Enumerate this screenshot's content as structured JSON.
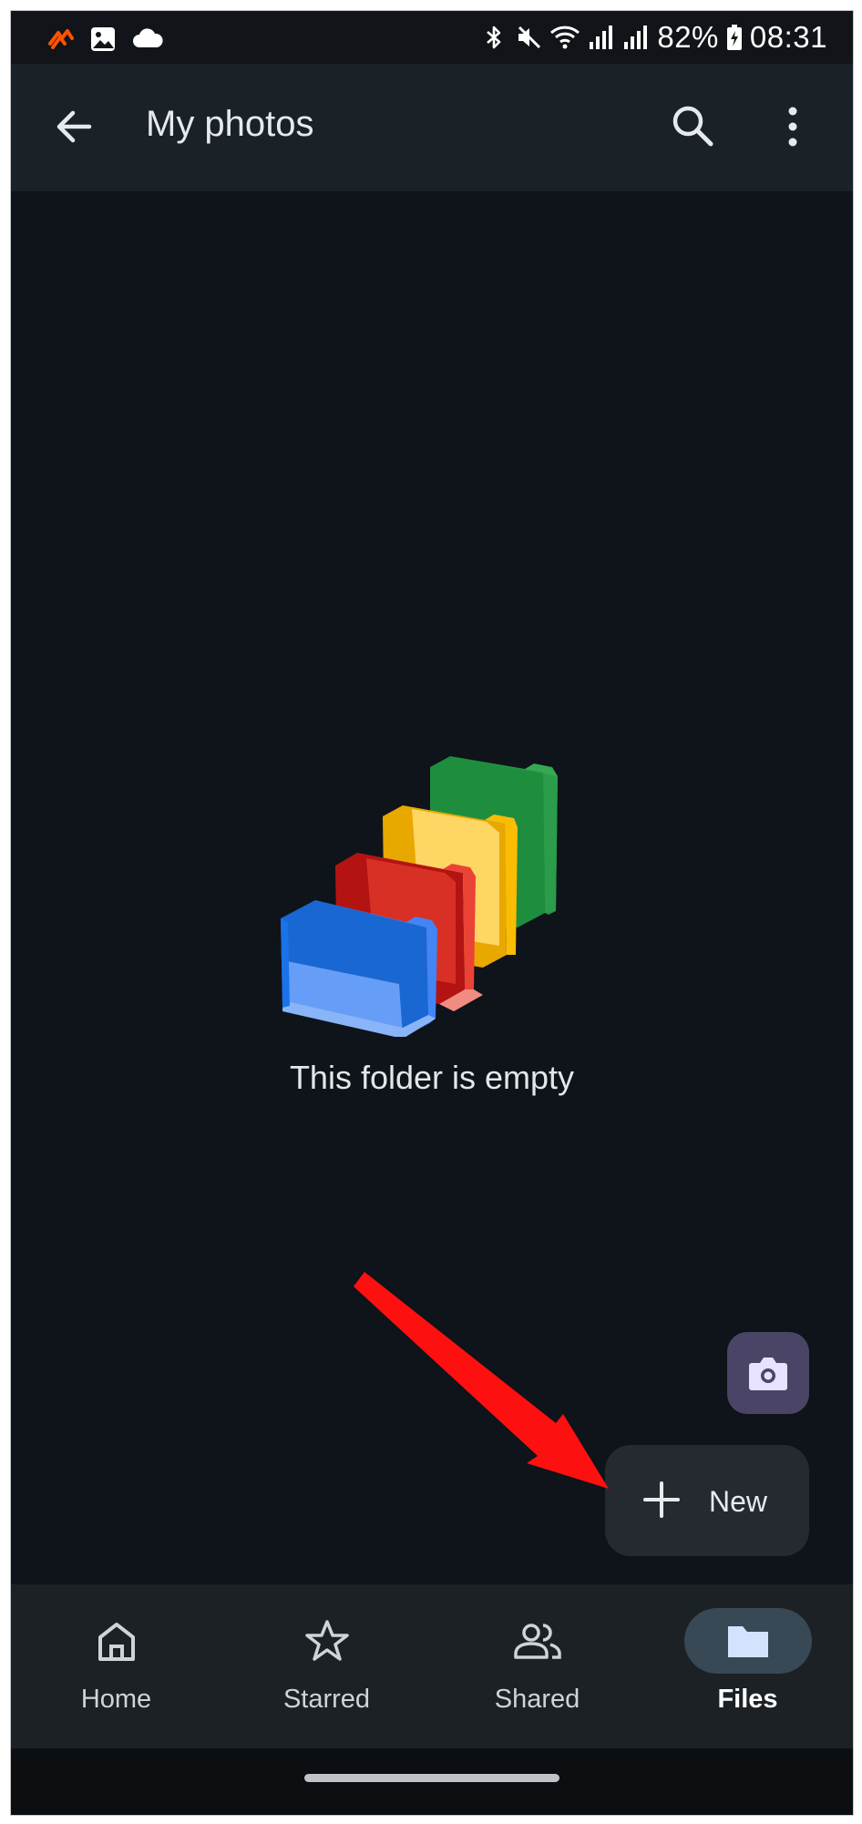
{
  "status_bar": {
    "battery": "82%",
    "time": "08:31",
    "left_icons": [
      "strava-icon",
      "gallery-icon",
      "cloud-icon"
    ],
    "right_icons": [
      "bluetooth-icon",
      "mute-icon",
      "wifi-icon",
      "signal-icon",
      "signal-icon",
      "battery-charging-icon"
    ]
  },
  "app_bar": {
    "title": "My photos",
    "back_icon": "arrow-back-icon",
    "search_icon": "search-icon",
    "more_icon": "more-vert-icon"
  },
  "empty_state": {
    "message": "This folder is empty",
    "illustration": "empty-folders-illustration",
    "colors": [
      "#34a853",
      "#fbbc04",
      "#ea4335",
      "#4285f4"
    ]
  },
  "fab": {
    "camera_icon": "camera-icon",
    "new_label": "New",
    "new_icon": "plus-icon"
  },
  "bottom_nav": {
    "items": [
      {
        "label": "Home",
        "icon": "home-icon",
        "active": false
      },
      {
        "label": "Starred",
        "icon": "star-icon",
        "active": false
      },
      {
        "label": "Shared",
        "icon": "shared-people-icon",
        "active": false
      },
      {
        "label": "Files",
        "icon": "folder-icon",
        "active": true
      }
    ]
  },
  "colors": {
    "background": "#0f131a",
    "app_bar": "#1a2227",
    "nav_bar": "#1c2126",
    "active_pill": "#384955",
    "camera_fab": "#4a4566",
    "new_fab": "#252a30",
    "annotation_arrow": "#ff1010"
  }
}
